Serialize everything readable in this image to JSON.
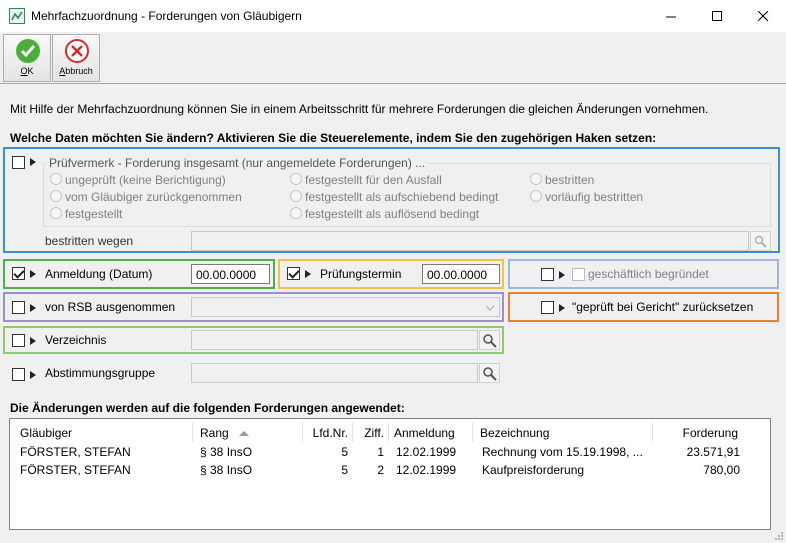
{
  "window": {
    "title": "Mehrfachzuordnung - Forderungen von Gläubigern"
  },
  "toolbar": {
    "ok_label_first": "O",
    "ok_label_rest": "K",
    "cancel_label_first": "A",
    "cancel_label_rest": "bbruch"
  },
  "intro": "Mit Hilfe der Mehrfachzuordnung können Sie in einem Arbeitsschritt für mehrere Forderungen die gleichen Änderungen vornehmen.",
  "question": "Welche Daten möchten Sie ändern? Aktivieren Sie die Steuerelemente, indem Sie den zugehörigen Haken setzen:",
  "pruefvermerk": {
    "label": "Prüfvermerk - Forderung insgesamt (nur angemeldete Forderungen) ...",
    "options": [
      "ungeprüft (keine Berichtigung)",
      "vom Gläubiger zurückgenommen",
      "festgestellt",
      "festgestellt für den Ausfall",
      "festgestellt als aufschiebend bedingt",
      "festgestellt als auflösend bedingt",
      "bestritten",
      "vorläufig bestritten"
    ],
    "bestritten_label": "bestritten wegen"
  },
  "anmeldung": {
    "label": "Anmeldung (Datum)",
    "value": "00.00.0000",
    "checked": true
  },
  "pruefungstermin": {
    "label": "Prüfungstermin",
    "value": "00.00.0000",
    "checked": true
  },
  "geschaeftlich": {
    "label": "geschäftlich begründet"
  },
  "rsb": {
    "label": "von RSB ausgenommen"
  },
  "gericht": {
    "label": "\"geprüft bei Gericht\" zurücksetzen"
  },
  "verzeichnis": {
    "label": "Verzeichnis"
  },
  "abstimmung": {
    "label": "Abstimmungsgruppe"
  },
  "list_title": "Die Änderungen werden auf die folgenden Forderungen angewendet:",
  "table": {
    "columns": [
      "Gläubiger",
      "Rang",
      "Lfd.Nr.",
      "Ziff.",
      "Anmeldung",
      "Bezeichnung",
      "Forderung"
    ],
    "rows": [
      [
        "FÖRSTER, STEFAN",
        "§ 38 InsO",
        "5",
        "1",
        "12.02.1999",
        "Rechnung vom 15.19.1998, ...",
        "23.571,91"
      ],
      [
        "FÖRSTER, STEFAN",
        "§ 38 InsO",
        "5",
        "2",
        "12.02.1999",
        "Kaufpreisforderung",
        "780,00"
      ]
    ]
  },
  "colors": {
    "blue": "#3c8fd4",
    "green": "#7cb84a",
    "yellow": "#f2c14e",
    "lightblue": "#9db8d8",
    "purple": "#9a8fd0",
    "orange": "#e8832a",
    "lightgreen": "#8fcb6a"
  }
}
